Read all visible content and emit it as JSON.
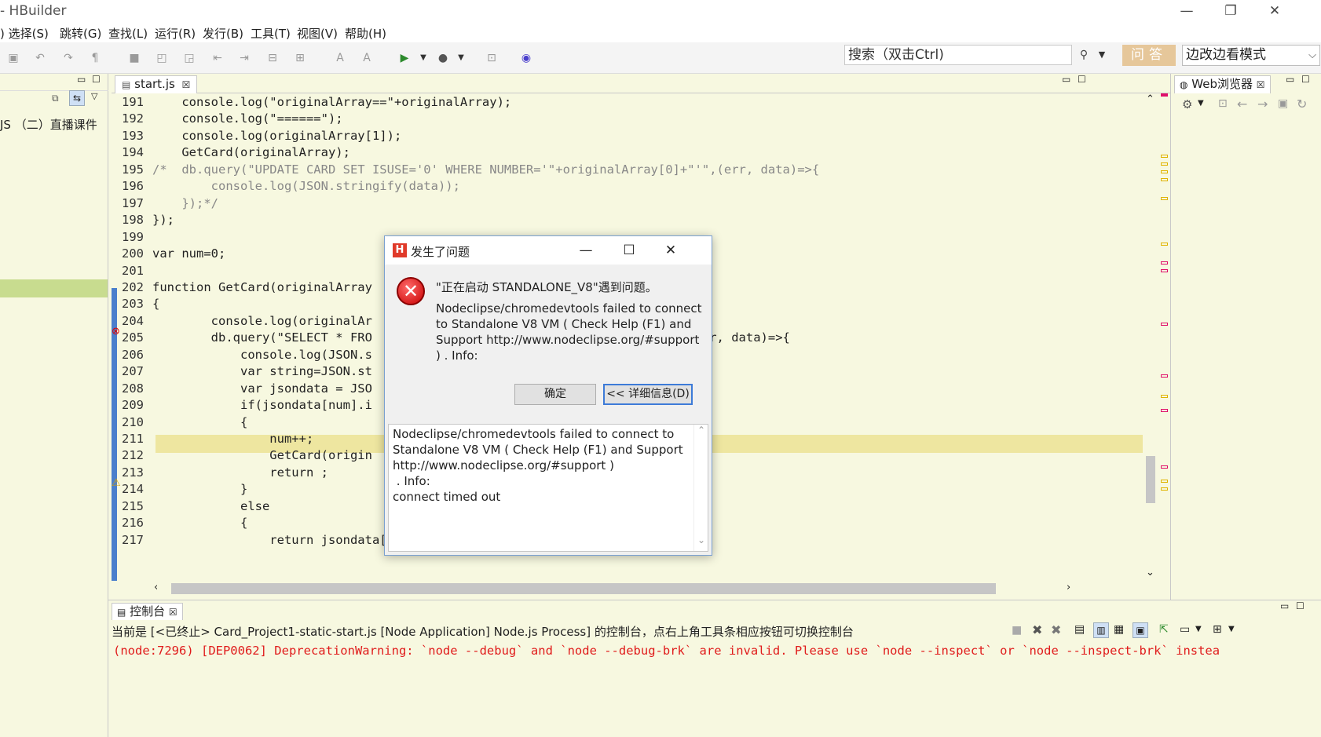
{
  "window": {
    "title": "HBuilder",
    "minimize": "—",
    "maximize": "❐",
    "close": "✕"
  },
  "menu": [
    "选择(S)",
    "跳转(G)",
    "查找(L)",
    "运行(R)",
    "发行(B)",
    "工具(T)",
    "视图(V)",
    "帮助(H)"
  ],
  "toolbar": {
    "search_placeholder": "搜索（双击Ctrl)",
    "ask_label": "问答",
    "mode_label": "边改边看模式"
  },
  "left_panel": {
    "tree_item": "JS （二）直播课件"
  },
  "editor": {
    "tab_label": "start.js",
    "lines": [
      {
        "n": "191",
        "code": "    console.log(\"originalArray==\"+originalArray);"
      },
      {
        "n": "192",
        "code": "    console.log(\"======\");"
      },
      {
        "n": "193",
        "code": "    console.log(originalArray[1]);"
      },
      {
        "n": "194",
        "code": "    GetCard(originalArray);"
      },
      {
        "n": "195",
        "code": "/*  db.query(\"UPDATE CARD SET ISUSE='0' WHERE NUMBER='\"+originalArray[0]+\"'\",(err, data)=>{"
      },
      {
        "n": "196",
        "code": "        console.log(JSON.stringify(data));"
      },
      {
        "n": "197",
        "code": "    });*/"
      },
      {
        "n": "198",
        "code": "});"
      },
      {
        "n": "199",
        "code": ""
      },
      {
        "n": "200",
        "code": "var num=0;"
      },
      {
        "n": "201",
        "code": ""
      },
      {
        "n": "202",
        "code": "function GetCard(originalArray"
      },
      {
        "n": "203",
        "code": "{"
      },
      {
        "n": "204",
        "code": "        console.log(originalAr"
      },
      {
        "n": "205",
        "code": "        db.query(\"SELECT * FRO                                       \"'\",(err, data)=>{"
      },
      {
        "n": "206",
        "code": "            console.log(JSON.s"
      },
      {
        "n": "207",
        "code": "            var string=JSON.st"
      },
      {
        "n": "208",
        "code": "            var jsondata = JSO"
      },
      {
        "n": "209",
        "code": "            if(jsondata[num].i"
      },
      {
        "n": "210",
        "code": "            {"
      },
      {
        "n": "211",
        "code": "                num++;"
      },
      {
        "n": "212",
        "code": "                GetCard(origin"
      },
      {
        "n": "213",
        "code": "                return ;"
      },
      {
        "n": "214",
        "code": "            }"
      },
      {
        "n": "215",
        "code": "            else"
      },
      {
        "n": "216",
        "code": "            {"
      },
      {
        "n": "217",
        "code": "                return jsondata[num].number;"
      }
    ]
  },
  "right_panel": {
    "tab_label": "Web浏览器"
  },
  "console": {
    "tab_label": "控制台",
    "header": "当前是 [<已终止> Card_Project1-static-start.js [Node Application] Node.js Process] 的控制台，点右上角工具条相应按钮可切换控制台",
    "output": "(node:7296) [DEP0062] DeprecationWarning: `node --debug` and `node --debug-brk` are invalid. Please use `node --inspect` or `node --inspect-brk` instea"
  },
  "dialog": {
    "title": "发生了问题",
    "heading": "\"正在启动 STANDALONE_V8\"遇到问题。",
    "body": "Nodeclipse/chromedevtools failed to connect to Standalone V8 VM ( Check Help (F1) and Support http://www.nodeclipse.org/#support ) . Info:",
    "ok_label": "确定",
    "details_label": "<< 详细信息(D)",
    "details_text": "Nodeclipse/chromedevtools failed to connect to Standalone V8 VM ( Check Help (F1) and Support http://www.nodeclipse.org/#support )\n . Info:\nconnect timed out",
    "minimize": "—",
    "maximize": "☐",
    "close": "✕"
  },
  "colors": {
    "editor_bg": "#f7f8e0",
    "current_line": "#eee6a0",
    "ask_button": "#e6c79a",
    "console_error": "#e01b1b",
    "gutter_marker": "#4a7fcc"
  }
}
